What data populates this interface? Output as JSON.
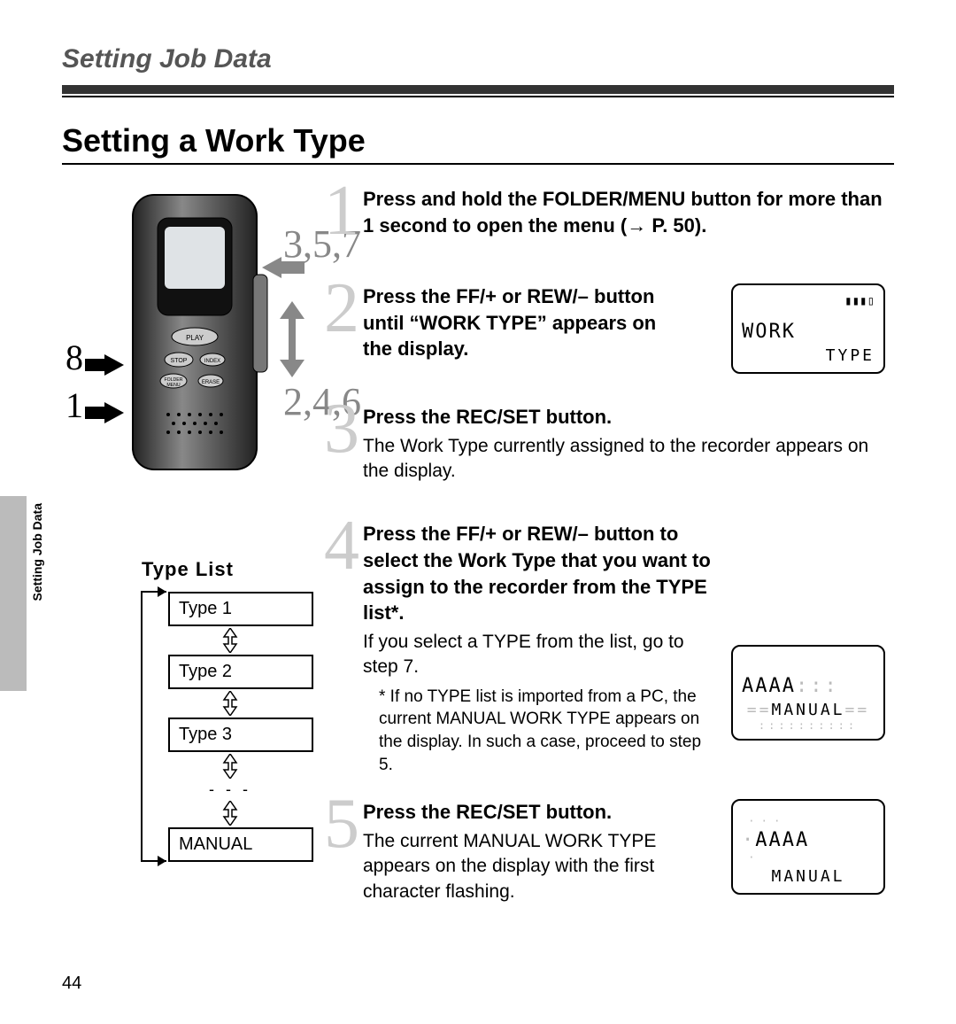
{
  "chapter": "Setting Job Data",
  "section_title": "Setting a Work Type",
  "page_number": "44",
  "sidetab_label": "Setting Job Data",
  "device_callouts": {
    "top_right": "3,5,7",
    "bottom_right": "2,4,6",
    "left_upper": "8",
    "left_lower": "1"
  },
  "device_buttons": {
    "play": "PLAY",
    "stop": "STOP",
    "index": "INDEX",
    "folder_menu": "FOLDER MENU",
    "erase": "ERASE"
  },
  "steps": [
    {
      "num": "1",
      "head": "Press and hold the FOLDER/MENU button for more than 1 second to open the menu (→ P. 50)."
    },
    {
      "num": "2",
      "head": "Press the FF/+ or REW/– button until “WORK TYPE” appears on the display.",
      "lcd1": "WORK",
      "lcd2": "TYPE"
    },
    {
      "num": "3",
      "head": "Press the REC/SET button.",
      "body": "The Work Type currently assigned to the recorder appears on the display."
    },
    {
      "num": "4",
      "head": "Press the FF/+ or REW/– button to select the Work Type that you want to assign to the recorder from the TYPE list*.",
      "body": "If you select a TYPE from the list, go to step 7.",
      "note": "* If no TYPE list is imported from a PC, the current MANUAL WORK TYPE appears on the display. In such a case, proceed to step 5.",
      "lcd1": "AAAA",
      "lcd2": "MANUAL"
    },
    {
      "num": "5",
      "head": "Press the REC/SET button.",
      "body": "The current MANUAL WORK TYPE appears on the display with the first character flashing.",
      "lcd1": "AAAA",
      "lcd2": "MANUAL"
    }
  ],
  "typelist": {
    "title": "Type  List",
    "items": [
      "Type 1",
      "Type 2",
      "Type 3",
      "MANUAL"
    ]
  }
}
